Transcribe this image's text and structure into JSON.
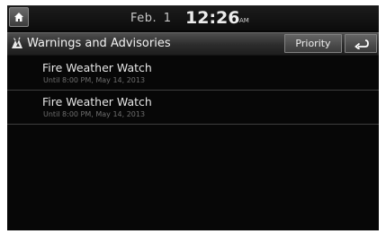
{
  "status_bar": {
    "date": "Feb. 1",
    "time": "12:26",
    "ampm": "AM",
    "home_icon": "home-icon"
  },
  "title_bar": {
    "title": "Warnings and Advisories",
    "warning_icon": "warning-icon",
    "priority_label": "Priority",
    "back_icon": "back-arrow-icon"
  },
  "advisories": [
    {
      "title": "Fire Weather Watch",
      "subtitle": "Until 8:00 PM, May 14, 2013"
    },
    {
      "title": "Fire Weather Watch",
      "subtitle": "Until 8:00 PM, May 14, 2013"
    }
  ],
  "colors": {
    "background": "#070707",
    "bar_top": "#4e4e4e",
    "text": "#e6e6e6",
    "subtext": "#6e6e6e"
  }
}
